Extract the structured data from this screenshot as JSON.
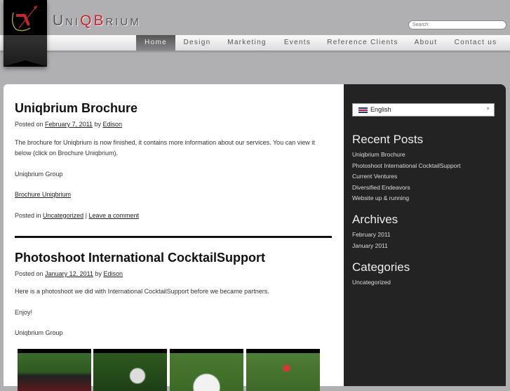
{
  "header": {
    "brand_pre": "Uni",
    "brand_q": "QB",
    "brand_post": "rium",
    "search_placeholder": "Search:"
  },
  "nav": [
    "Home",
    "Design",
    "Marketing",
    "Events",
    "Reference Clients",
    "About",
    "Contact us"
  ],
  "posts": [
    {
      "title": "Uniqbrium Brochure",
      "posted_on": "Posted on",
      "date": "February 7, 2011",
      "by": "by",
      "author": "Edison",
      "paragraphs": [
        "The brochure  for Uniqbrium is now finished, it contains more information about our services. You can view it below (click on Brochure Uniqbrium).",
        "Uniqbrium Group"
      ],
      "link": "Brochure Uniqbrium",
      "posted_in": "Posted in",
      "category": "Uncategorized",
      "sep": "|",
      "comment": "Leave a comment"
    },
    {
      "title": "Photoshoot International CocktailSupport",
      "posted_on": "Posted on",
      "date": "January 12, 2011",
      "by": "by",
      "author": "Edison",
      "paragraphs": [
        "Here is a photoshoot we did with International CocktailSupport before we became partners.",
        "Enjoy!",
        "Uniqbrium Group"
      ]
    }
  ],
  "sidebar": {
    "language": "English",
    "recent_title": "Recent Posts",
    "recent": [
      "Uniqbrium Brochure",
      "Photoshoot International CocktailSupport",
      "Current Ventures",
      "Diversified Endeavors",
      "Website up & running"
    ],
    "archives_title": "Archives",
    "archives": [
      "February 2011",
      "January 2011"
    ],
    "categories_title": "Categories",
    "categories": [
      "Uncategorized"
    ]
  }
}
